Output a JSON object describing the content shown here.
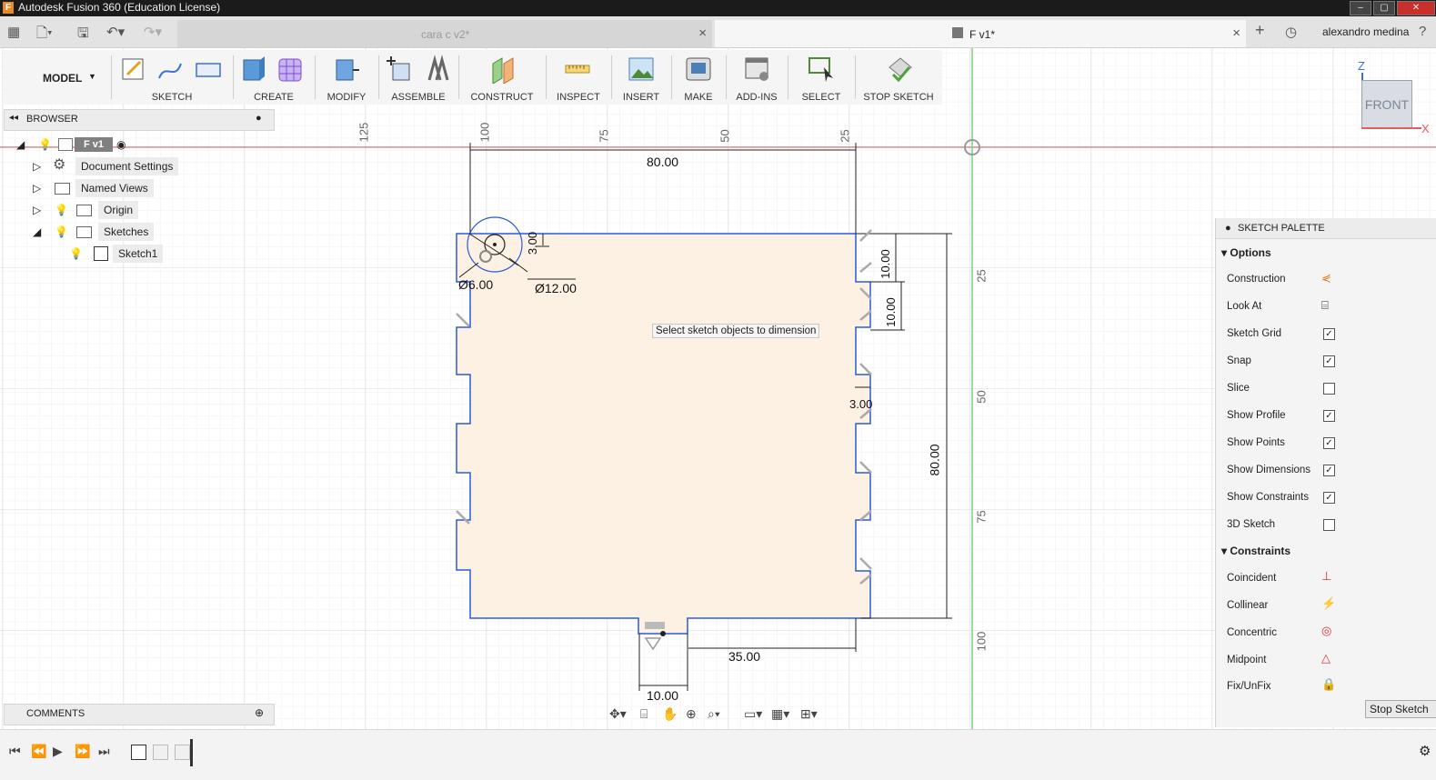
{
  "window": {
    "title": "Autodesk Fusion 360 (Education License)"
  },
  "tabs": [
    {
      "label": "cara c v2*",
      "active": false
    },
    {
      "label": "F v1*",
      "active": true
    }
  ],
  "user": {
    "name": "alexandro medina"
  },
  "toolbar": {
    "workspace": "MODEL",
    "groups": [
      "SKETCH",
      "CREATE",
      "MODIFY",
      "ASSEMBLE",
      "CONSTRUCT",
      "INSPECT",
      "INSERT",
      "MAKE",
      "ADD-INS",
      "SELECT",
      "STOP SKETCH"
    ]
  },
  "browser": {
    "title": "BROWSER",
    "root": "F v1",
    "items": [
      "Document Settings",
      "Named Views",
      "Origin",
      "Sketches",
      "Sketch1"
    ]
  },
  "comments": {
    "title": "COMMENTS"
  },
  "canvas": {
    "tooltip": "Select sketch objects to dimension",
    "dimensions": [
      "80.00",
      "Ø6.00",
      "Ø12.00",
      "3.00",
      "10.00",
      "10.00",
      "3.00",
      "80.00",
      "35.00",
      "10.00"
    ],
    "ruler_top": [
      "125",
      "100",
      "75",
      "50",
      "25"
    ],
    "ruler_right": [
      "25",
      "50",
      "75",
      "100"
    ],
    "viewcube": {
      "face": "FRONT",
      "axis_z": "Z",
      "axis_x": "X"
    }
  },
  "palette": {
    "title": "SKETCH PALETTE",
    "options_header": "Options",
    "options": [
      {
        "label": "Construction",
        "type": "icon"
      },
      {
        "label": "Look At",
        "type": "icon"
      },
      {
        "label": "Sketch Grid",
        "type": "check",
        "checked": "✓"
      },
      {
        "label": "Snap",
        "type": "check",
        "checked": "✓"
      },
      {
        "label": "Slice",
        "type": "check",
        "checked": ""
      },
      {
        "label": "Show Profile",
        "type": "check",
        "checked": "✓"
      },
      {
        "label": "Show Points",
        "type": "check",
        "checked": "✓"
      },
      {
        "label": "Show Dimensions",
        "type": "check",
        "checked": "✓"
      },
      {
        "label": "Show Constraints",
        "type": "check",
        "checked": "✓"
      },
      {
        "label": "3D Sketch",
        "type": "check",
        "checked": ""
      }
    ],
    "constraints_header": "Constraints",
    "constraints": [
      "Coincident",
      "Collinear",
      "Concentric",
      "Midpoint",
      "Fix/UnFix"
    ],
    "stop_button": "Stop Sketch"
  },
  "colors": {
    "profile_fill": "#fdf1e4",
    "sketch_line": "#2a5bd7",
    "x_axis": "#e06060",
    "y_axis": "#7fd07f"
  }
}
